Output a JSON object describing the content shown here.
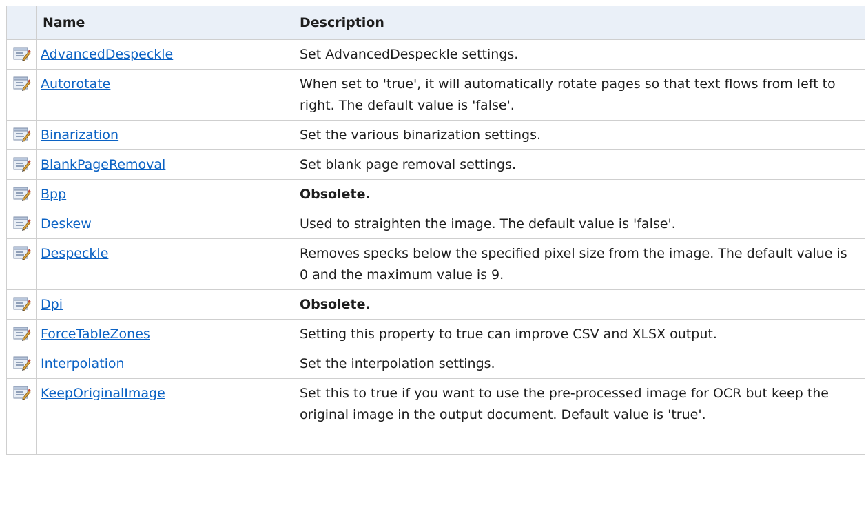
{
  "header": {
    "name": "Name",
    "description": "Description"
  },
  "rows": [
    {
      "name": "AdvancedDespeckle",
      "description": "Set AdvancedDespeckle settings.",
      "bold": false,
      "height": 43
    },
    {
      "name": "Autorotate",
      "description": "When set to 'true', it will automatically rotate pages so that text flows from left to right. The default value is 'false'.",
      "bold": false,
      "height": 74
    },
    {
      "name": "Binarization",
      "description": "Set the various binarization settings.",
      "bold": false,
      "height": 42
    },
    {
      "name": "BlankPageRemoval",
      "description": "Set blank page removal settings.",
      "bold": false,
      "height": 43
    },
    {
      "name": "Bpp",
      "description": "Obsolete.",
      "bold": true,
      "height": 42
    },
    {
      "name": "Deskew",
      "description": "Used to straighten the image. The default value is 'false'.",
      "bold": false,
      "height": 42
    },
    {
      "name": "Despeckle",
      "description": "Removes specks below the specified pixel size from the image. The default value is 0 and the maximum value is 9.",
      "bold": false,
      "height": 74
    },
    {
      "name": "Dpi",
      "description": "Obsolete.",
      "bold": true,
      "height": 42
    },
    {
      "name": "ForceTableZones",
      "description": "Setting this property to true can improve CSV and XLSX output.",
      "bold": false,
      "height": 43
    },
    {
      "name": "Interpolation",
      "description": "Set the interpolation settings.",
      "bold": false,
      "height": 42
    },
    {
      "name": "KeepOriginalImage",
      "description": "Set this to true if you want to use the pre-processed image for OCR but keep the original image in the output document. Default value is 'true'.",
      "bold": false,
      "height": 110
    }
  ],
  "icons": {
    "property": "property-icon"
  }
}
